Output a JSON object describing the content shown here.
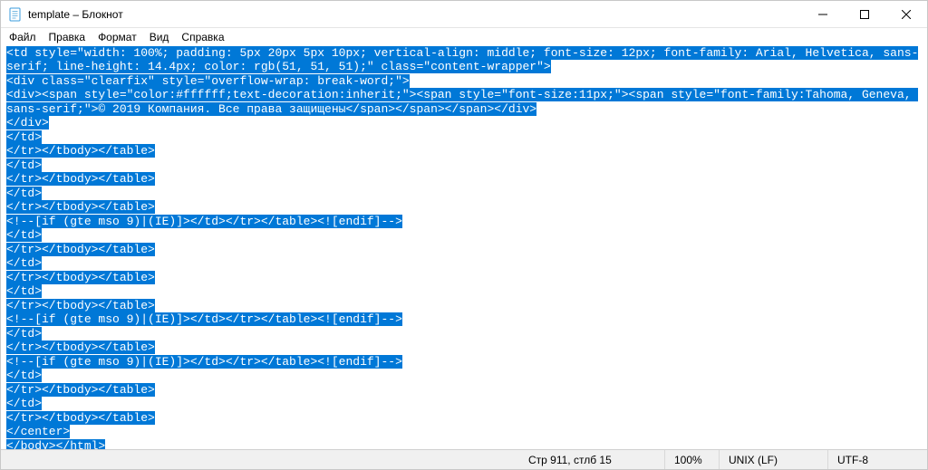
{
  "title": "template – Блокнот",
  "menu": {
    "file": "Файл",
    "edit": "Правка",
    "format": "Формат",
    "view": "Вид",
    "help": "Справка"
  },
  "content_lines": [
    "<td style=\"width: 100%; padding: 5px 20px 5px 10px; vertical-align: middle; font-size: 12px; font-family: Arial, Helvetica, sans-serif; line-height: 14.4px; color: rgb(51, 51, 51);\" class=\"content-wrapper\">",
    "<div class=\"clearfix\" style=\"overflow-wrap: break-word;\">",
    "<div><span style=\"color:#ffffff;text-decoration:inherit;\"><span style=\"font-size:11px;\"><span style=\"font-family:Tahoma, Geneva, sans-serif;\">© 2019 Компания. Все права защищены</span></span></span></div>",
    "</div>",
    "</td>",
    "</tr></tbody></table>",
    "</td>",
    "</tr></tbody></table>",
    "</td>",
    "</tr></tbody></table>",
    "<!--[if (gte mso 9)|(IE)]></td></tr></table><![endif]-->",
    "</td>",
    "</tr></tbody></table>",
    "</td>",
    "</tr></tbody></table>",
    "</td>",
    "</tr></tbody></table>",
    "<!--[if (gte mso 9)|(IE)]></td></tr></table><![endif]-->",
    "</td>",
    "</tr></tbody></table>",
    "<!--[if (gte mso 9)|(IE)]></td></tr></table><![endif]-->",
    "</td>",
    "</tr></tbody></table>",
    "</td>",
    "</tr></tbody></table>",
    "</center>",
    "</body></html>"
  ],
  "status": {
    "position": "Стр 911, стлб 15",
    "zoom": "100%",
    "eol": "UNIX (LF)",
    "encoding": "UTF-8"
  }
}
